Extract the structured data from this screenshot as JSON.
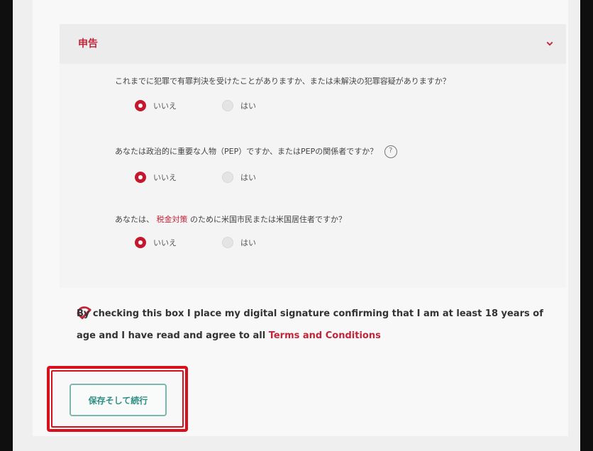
{
  "section": {
    "title": "申告",
    "questions": [
      {
        "text_a": "これまでに犯罪で有罪判決を受けたことがありますか、または未解決の犯罪容疑がありますか？",
        "text_highlight": "",
        "text_b": "",
        "options": [
          "いいえ",
          "はい"
        ],
        "selected": "いいえ",
        "help_icon": ""
      },
      {
        "text_a": "あなたは政治的に重要な人物（PEP）ですか、またはPEPの関係者ですか？",
        "text_highlight": "",
        "text_b": "",
        "options": [
          "いいえ",
          "はい"
        ],
        "selected": "いいえ",
        "help_icon": "?"
      },
      {
        "text_a": "あなたは、",
        "text_highlight": "税金対策",
        "text_b": "のために米国市民または米国居住者ですか？",
        "options": [
          "いいえ",
          "はい"
        ],
        "selected": "いいえ",
        "help_icon": ""
      }
    ]
  },
  "consent": {
    "text": "By checking this box I place my digital signature confirming that I am at least 18 years of age and I have read and agree to all ",
    "link_text": "Terms and Conditions",
    "checked": true
  },
  "actions": {
    "save_label": "保存そして続行"
  },
  "colors": {
    "accent": "#c0263a",
    "button_text": "#2f8e83",
    "button_border": "#7db6ae",
    "highlight": "#d9101b"
  }
}
